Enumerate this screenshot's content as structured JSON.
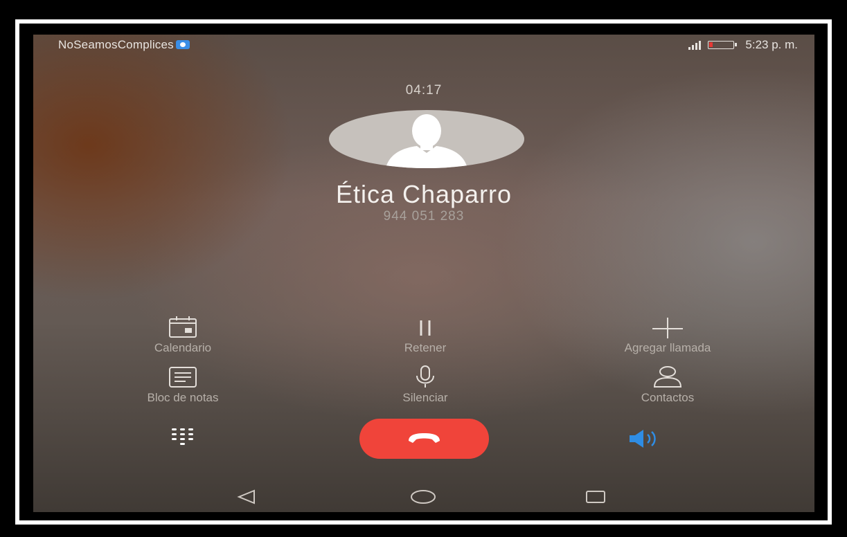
{
  "status_bar": {
    "carrier": "NoSeamosComplices",
    "time": "5:23 p. m."
  },
  "call": {
    "duration": "04:17",
    "contact_name": "Ética Chaparro",
    "phone_number": "944 051 283"
  },
  "actions": {
    "calendar": "Calendario",
    "hold": "Retener",
    "add_call": "Agregar llamada",
    "notes": "Bloc de notas",
    "mute": "Silenciar",
    "contacts": "Contactos"
  },
  "icons": {
    "carrier_badge": "shield-icon",
    "signal": "signal-icon",
    "battery": "battery-icon",
    "avatar": "person-silhouette-icon",
    "calendar": "calendar-icon",
    "hold": "pause-icon",
    "add_call": "plus-icon",
    "notes": "notepad-icon",
    "mute": "microphone-icon",
    "contacts": "person-icon",
    "dialpad": "dialpad-icon",
    "end_call": "phone-hangup-icon",
    "speaker": "speaker-icon",
    "back": "back-triangle-icon",
    "home": "home-circle-icon",
    "recents": "recents-square-icon"
  },
  "colors": {
    "end_call": "#f0443a",
    "speaker_active": "#2f8de4",
    "battery_low": "#e53935"
  }
}
